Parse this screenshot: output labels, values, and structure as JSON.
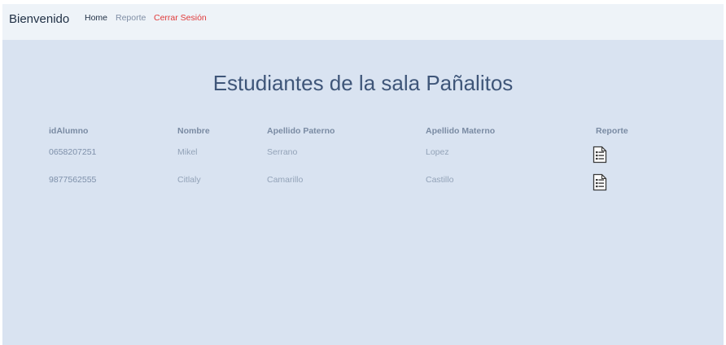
{
  "navbar": {
    "brand": "Bienvenido",
    "links": {
      "home": "Home",
      "reporte": "Reporte",
      "logout": "Cerrar Sesión"
    }
  },
  "main": {
    "title": "Estudiantes de la sala Pañalitos",
    "table": {
      "headers": [
        "idAlumno",
        "Nombre",
        "Apellido Paterno",
        "Apellido Materno",
        "Reporte"
      ],
      "rows": [
        {
          "id": "0658207251",
          "nombre": "Mikel",
          "paterno": "Serrano",
          "materno": "Lopez",
          "reporte_icon": "report-document-icon"
        },
        {
          "id": "9877562555",
          "nombre": "Citlaly",
          "paterno": "Camarillo",
          "materno": "Castillo",
          "reporte_icon": "report-document-icon"
        }
      ]
    }
  },
  "colors": {
    "background": "#d9e3f1",
    "navbar": "#eef3f8",
    "title": "#3f5679",
    "logout": "#e03a3a"
  }
}
